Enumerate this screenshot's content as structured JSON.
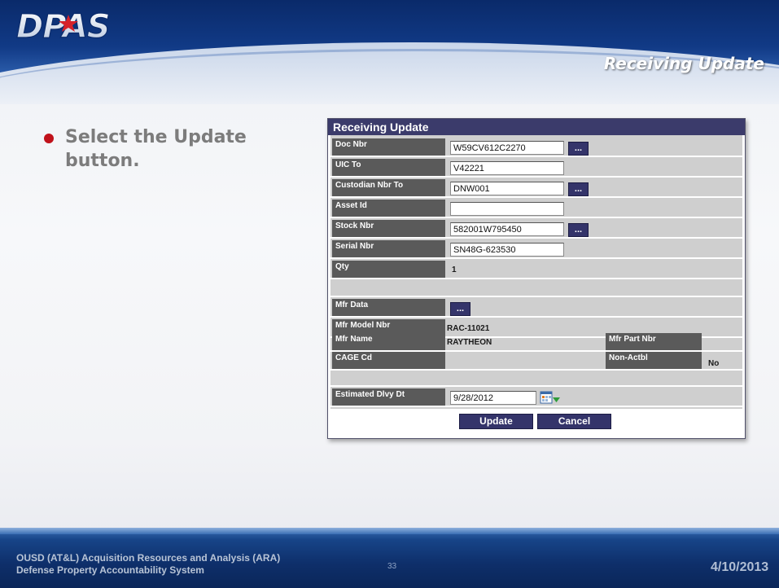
{
  "header": {
    "logo_text": "DPAS",
    "slide_title": "Receiving Update"
  },
  "bullet": {
    "text": "Select the Update button."
  },
  "form": {
    "title": "Receiving Update",
    "doc_nbr": {
      "label": "Doc Nbr",
      "value": "W59CV612C2270",
      "lookup": "..."
    },
    "uic_to": {
      "label": "UIC To",
      "value": "V42221"
    },
    "custodian_nbr_to": {
      "label": "Custodian Nbr To",
      "value": "DNW001",
      "lookup": "..."
    },
    "asset_id": {
      "label": "Asset Id",
      "value": ""
    },
    "stock_nbr": {
      "label": "Stock Nbr",
      "value": "582001W795450",
      "lookup": "..."
    },
    "serial_nbr": {
      "label": "Serial Nbr",
      "value": "SN48G-623530"
    },
    "qty": {
      "label": "Qty",
      "value": "1"
    },
    "mfr_data": {
      "label": "Mfr Data",
      "lookup": "..."
    },
    "mfr_model_nbr": {
      "label": "Mfr Model Nbr",
      "value": "RAC-11021"
    },
    "mfr_name": {
      "label": "Mfr Name",
      "value": "RAYTHEON"
    },
    "mfr_part_nbr": {
      "label": "Mfr Part Nbr",
      "value": ""
    },
    "cage_cd": {
      "label": "CAGE Cd",
      "value": ""
    },
    "non_actbl": {
      "label": "Non-Actbl",
      "value": "No"
    },
    "estimated_dlvy_dt": {
      "label": "Estimated Dlvy Dt",
      "value": "9/28/2012"
    },
    "update_button": "Update",
    "cancel_button": "Cancel"
  },
  "footer": {
    "org_line1": "OUSD (AT&L) Acquisition Resources and Analysis (ARA)",
    "org_line2": "Defense Property Accountability System",
    "slide_number": "33",
    "date": "4/10/2013"
  },
  "colors": {
    "header_navy": "#113a86",
    "form_title_bg": "#3b3b6b",
    "label_bg": "#5a5a5a",
    "button_bg": "#34346a",
    "bullet_red": "#c0121b"
  }
}
